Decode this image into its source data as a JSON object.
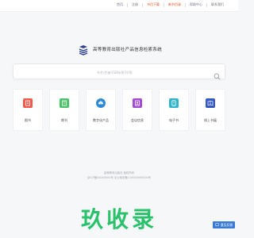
{
  "topnav": {
    "items": [
      {
        "label": "首页"
      },
      {
        "label": "注册"
      },
      {
        "label": "书目下载"
      },
      {
        "label": "新书目录"
      },
      {
        "label": "帮助中心"
      },
      {
        "label": "联系我们"
      }
    ]
  },
  "brand": {
    "title": "高等教育出版社产品信息检索系统",
    "logo_icon": "book-stack-logo-icon"
  },
  "search": {
    "placeholder": "书名/作者/ISBN/系列/等",
    "button_icon": "search-icon"
  },
  "cards": [
    {
      "label": "图书",
      "icon": "book-icon",
      "color": "#f15a4a"
    },
    {
      "label": "期刊",
      "icon": "journal-icon",
      "color": "#4cc36a"
    },
    {
      "label": "数字化产品",
      "icon": "cloud-download-icon",
      "color": "#2b8bd6"
    },
    {
      "label": "会议信息",
      "icon": "meeting-icon",
      "color": "#a44bd6"
    },
    {
      "label": "电子书",
      "icon": "ebook-icon",
      "color": "#2fb4c9"
    },
    {
      "label": "线上书展",
      "icon": "online-expo-icon",
      "color": "#3357c4"
    }
  ],
  "footer": {
    "line1": "高等教育出版社  版权所有",
    "line2": "京ICP备05000000号  京公网安备110000000000号"
  },
  "watermark": {
    "text": "玖收录"
  },
  "feedback": {
    "label": "意见反馈"
  },
  "colors": {
    "accent_orange": "#e64a19",
    "feedback_blue": "#3a7bd5",
    "watermark_green": "#29c26b"
  }
}
